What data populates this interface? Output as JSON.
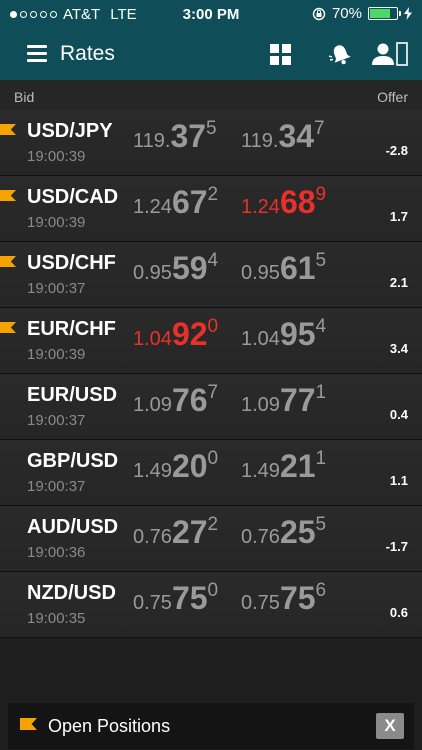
{
  "status": {
    "carrier": "AT&T",
    "network": "LTE",
    "time": "3:00 PM",
    "battery": "70%",
    "signal_dots_filled": 1,
    "signal_dots_total": 5
  },
  "nav": {
    "title": "Rates"
  },
  "columns": {
    "bid": "Bid",
    "offer": "Offer"
  },
  "colors": {
    "header_bg": "#0f4d59",
    "flag": "#f5a300",
    "up_red": "#e8312a"
  },
  "rows": [
    {
      "pair": "USD/JPY",
      "time": "19:00:39",
      "flagged": true,
      "bid": {
        "prefix": "119.",
        "big": "37",
        "sup": "5",
        "red": false
      },
      "offer": {
        "prefix": "119.",
        "big": "34",
        "sup": "7",
        "red": false
      },
      "change": "-2.8"
    },
    {
      "pair": "USD/CAD",
      "time": "19:00:39",
      "flagged": true,
      "bid": {
        "prefix": "1.24",
        "big": "67",
        "sup": "2",
        "red": false
      },
      "offer": {
        "prefix": "1.24",
        "big": "68",
        "sup": "9",
        "red": true
      },
      "change": "1.7"
    },
    {
      "pair": "USD/CHF",
      "time": "19:00:37",
      "flagged": true,
      "bid": {
        "prefix": "0.95",
        "big": "59",
        "sup": "4",
        "red": false
      },
      "offer": {
        "prefix": "0.95",
        "big": "61",
        "sup": "5",
        "red": false
      },
      "change": "2.1"
    },
    {
      "pair": "EUR/CHF",
      "time": "19:00:39",
      "flagged": true,
      "bid": {
        "prefix": "1.04",
        "big": "92",
        "sup": "0",
        "red": true
      },
      "offer": {
        "prefix": "1.04",
        "big": "95",
        "sup": "4",
        "red": false
      },
      "change": "3.4"
    },
    {
      "pair": "EUR/USD",
      "time": "19:00:37",
      "flagged": false,
      "bid": {
        "prefix": "1.09",
        "big": "76",
        "sup": "7",
        "red": false
      },
      "offer": {
        "prefix": "1.09",
        "big": "77",
        "sup": "1",
        "red": false
      },
      "change": "0.4"
    },
    {
      "pair": "GBP/USD",
      "time": "19:00:37",
      "flagged": false,
      "bid": {
        "prefix": "1.49",
        "big": "20",
        "sup": "0",
        "red": false
      },
      "offer": {
        "prefix": "1.49",
        "big": "21",
        "sup": "1",
        "red": false
      },
      "change": "1.1"
    },
    {
      "pair": "AUD/USD",
      "time": "19:00:36",
      "flagged": false,
      "bid": {
        "prefix": "0.76",
        "big": "27",
        "sup": "2",
        "red": false
      },
      "offer": {
        "prefix": "0.76",
        "big": "25",
        "sup": "5",
        "red": false
      },
      "change": "-1.7"
    },
    {
      "pair": "NZD/USD",
      "time": "19:00:35",
      "flagged": false,
      "bid": {
        "prefix": "0.75",
        "big": "75",
        "sup": "0",
        "red": false
      },
      "offer": {
        "prefix": "0.75",
        "big": "75",
        "sup": "6",
        "red": false
      },
      "change": "0.6"
    }
  ],
  "bottom_bar": {
    "label": "Open Positions",
    "close_label": "X"
  }
}
